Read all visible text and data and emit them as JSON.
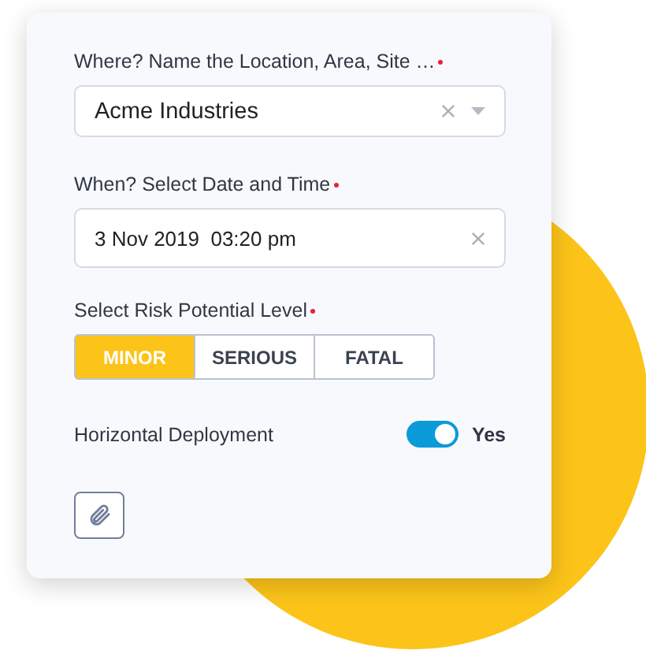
{
  "location": {
    "label": "Where? Name the Location, Area, Site …",
    "required": true,
    "value": "Acme Industries"
  },
  "when": {
    "label": "When? Select Date and Time",
    "required": true,
    "value": "3 Nov 2019  03:20 pm"
  },
  "risk": {
    "label": "Select Risk Potential Level",
    "required": true,
    "options": [
      {
        "label": "MINOR",
        "selected": true
      },
      {
        "label": "SERIOUS",
        "selected": false
      },
      {
        "label": "FATAL",
        "selected": false
      }
    ]
  },
  "deployment": {
    "label": "Horizontal Deployment",
    "on": true,
    "value": "Yes"
  }
}
